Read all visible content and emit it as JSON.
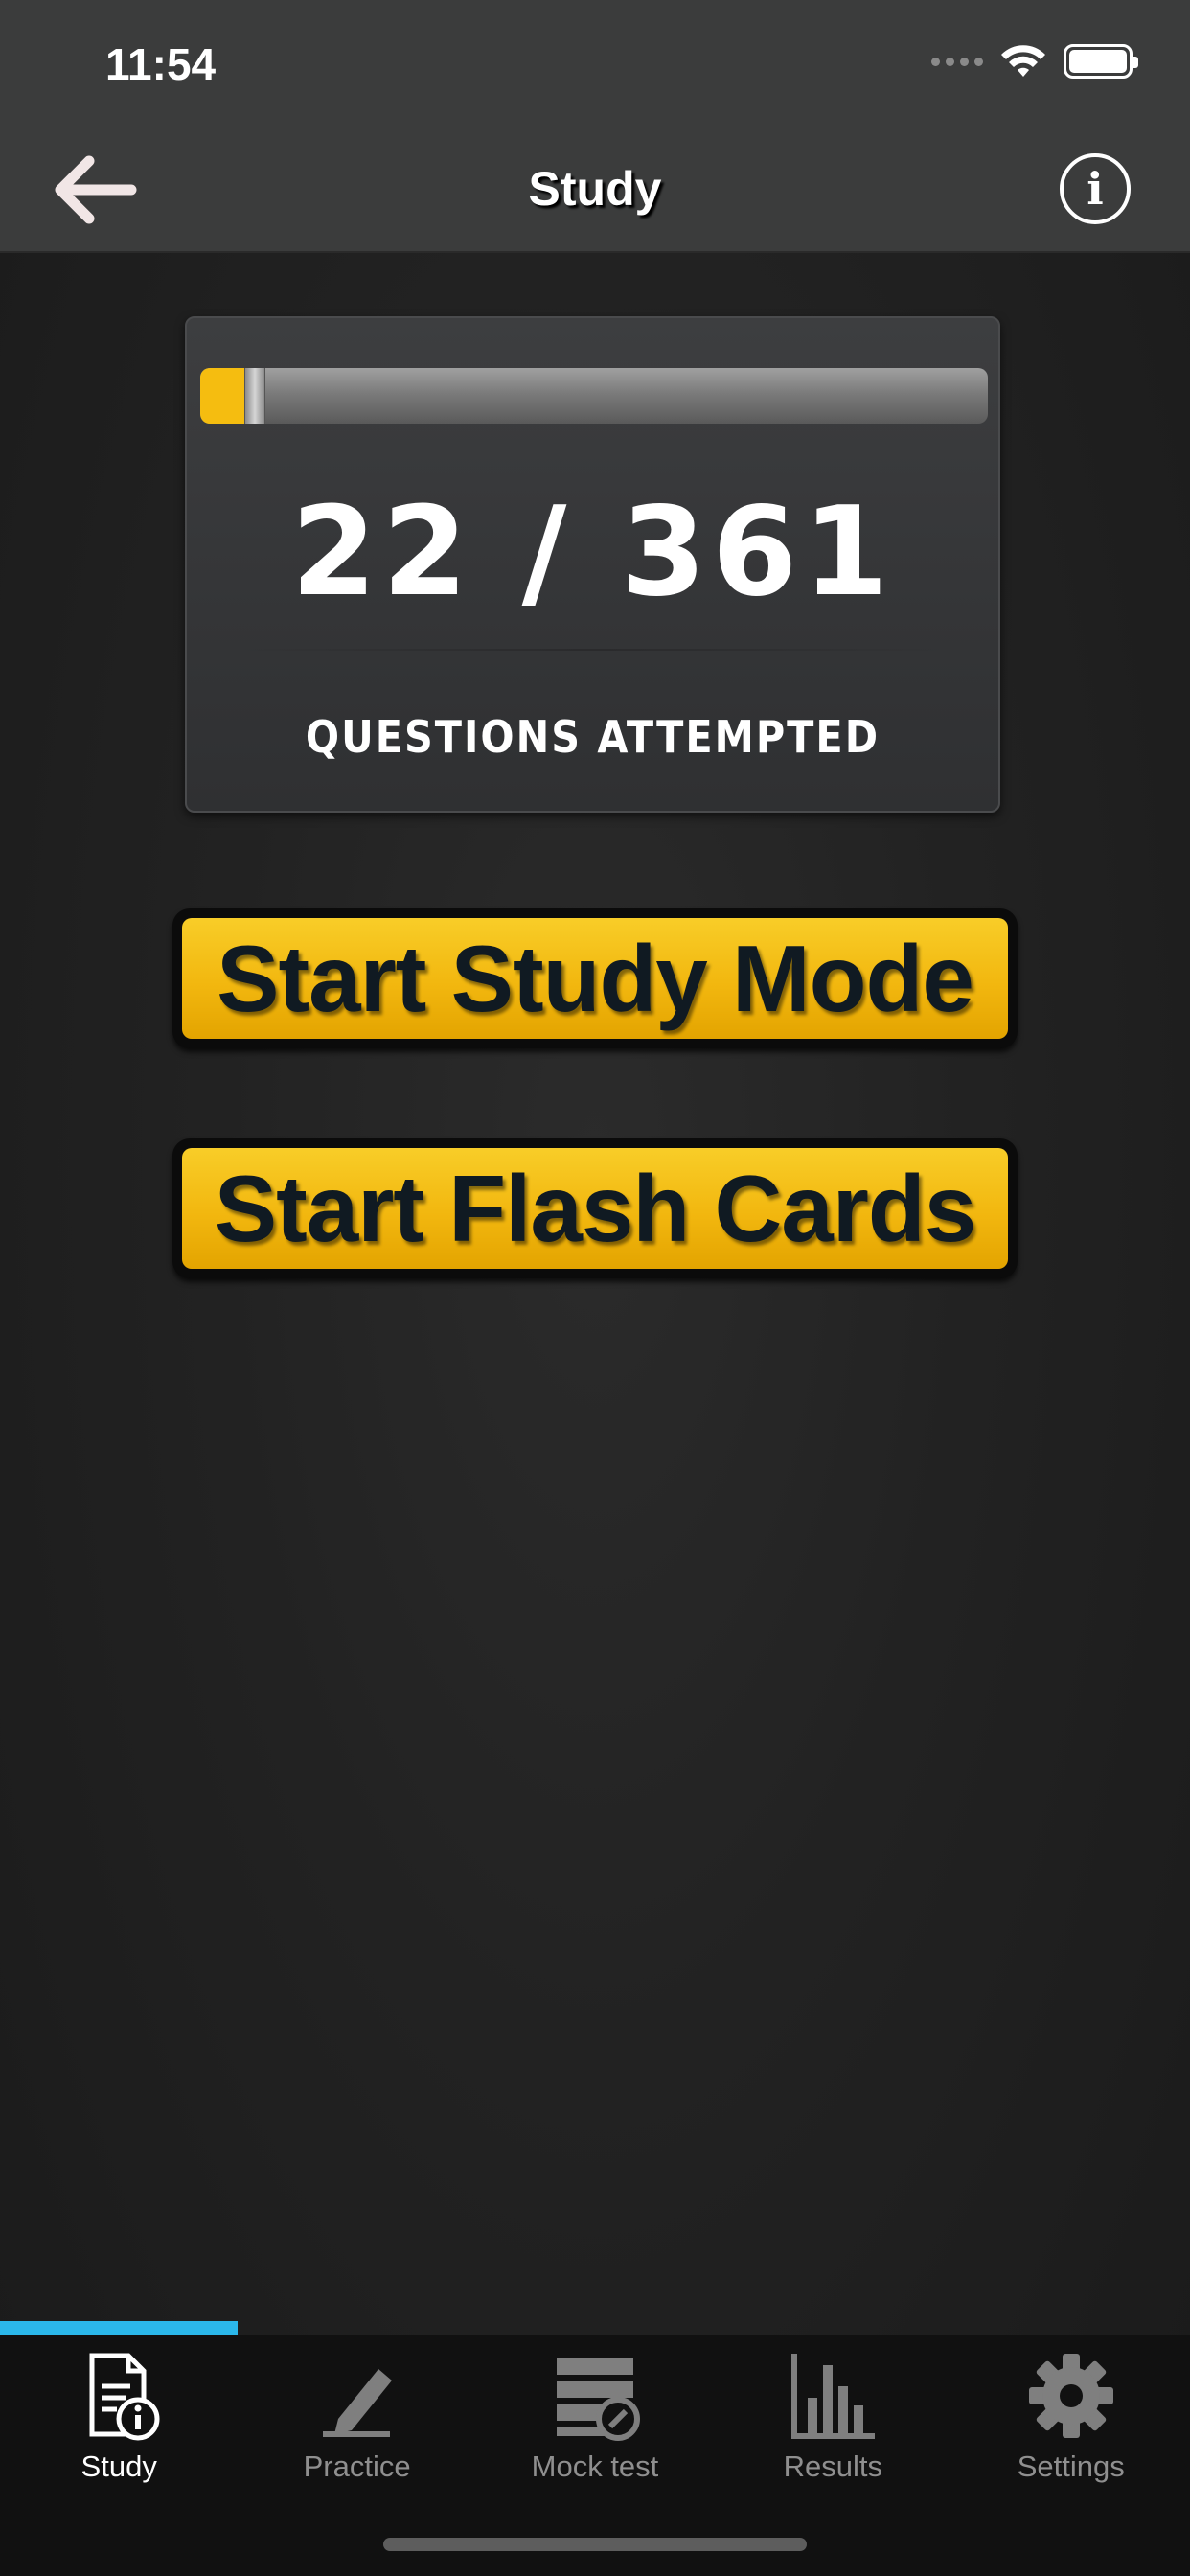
{
  "status_bar": {
    "time": "11:54"
  },
  "nav": {
    "title": "Study",
    "back_icon": "arrow-left-icon",
    "info_icon": "info-icon",
    "info_glyph": "i"
  },
  "progress": {
    "attempted": 22,
    "total": 361,
    "count_text": "22 / 361",
    "label": "QUESTIONS ATTEMPTED",
    "fill_fraction": 0.061,
    "fill_color": "#f5bd10"
  },
  "buttons": {
    "study_mode": "Start Study Mode",
    "flash_cards": "Start Flash Cards",
    "accent_color": "#f2b70f"
  },
  "tabs": [
    {
      "label": "Study",
      "icon": "study-doc-info-icon",
      "active": true
    },
    {
      "label": "Practice",
      "icon": "pencil-icon",
      "active": false
    },
    {
      "label": "Mock test",
      "icon": "mock-test-icon",
      "active": false
    },
    {
      "label": "Results",
      "icon": "bar-chart-icon",
      "active": false
    },
    {
      "label": "Settings",
      "icon": "gear-icon",
      "active": false
    }
  ],
  "tab_indicator_color": "#2bb7ea"
}
